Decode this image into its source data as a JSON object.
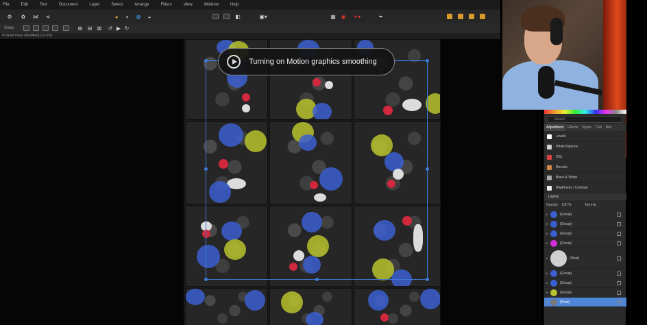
{
  "menubar": [
    "File",
    "Edit",
    "Text",
    "Document",
    "Layer",
    "Select",
    "Arrange",
    "Filters",
    "View",
    "Window",
    "Help"
  ],
  "document": {
    "title": "rrt dead maps (Modified) (24.6%)"
  },
  "toolbar": {
    "mode_label": "Snap"
  },
  "toast": {
    "text": "Turning on Motion graphics smoothing"
  },
  "panel": {
    "search_placeholder": "Search",
    "tabs": [
      "Adjustment",
      "Effects",
      "Styles",
      "Clut",
      "Bits"
    ],
    "adjustments": [
      {
        "label": "Levels",
        "color": "#ffffff"
      },
      {
        "label": "White Balance",
        "color": "#cfcfcf"
      },
      {
        "label": "HSL",
        "color": "#d44"
      },
      {
        "label": "Recolor",
        "color": "#c84"
      },
      {
        "label": "Black & White",
        "color": "#aaaaaa"
      },
      {
        "label": "Brightness / Contrast",
        "color": "#eeeeee"
      }
    ],
    "layers_title": "Layers",
    "opacity_label": "Opacity:",
    "opacity_value": "100 %",
    "blend_mode": "Normal",
    "layers": [
      {
        "label": "(Group)",
        "color": "#3b5fd0"
      },
      {
        "label": "(Group)",
        "color": "#3b5fd0"
      },
      {
        "label": "(Group)",
        "color": "#3b5fd0"
      },
      {
        "label": "(Group)",
        "color": "#d22fd8"
      },
      {
        "label": "(Pixel)",
        "color": "#cfcfcf",
        "big": true
      },
      {
        "label": "(Group)",
        "color": "#3b5fd0"
      },
      {
        "label": "(Group)",
        "color": "#3b5fd0"
      },
      {
        "label": "(Group)",
        "color": "#b9c22e"
      },
      {
        "label": "(Pixel)",
        "color": "#777777",
        "selected": true
      }
    ]
  }
}
